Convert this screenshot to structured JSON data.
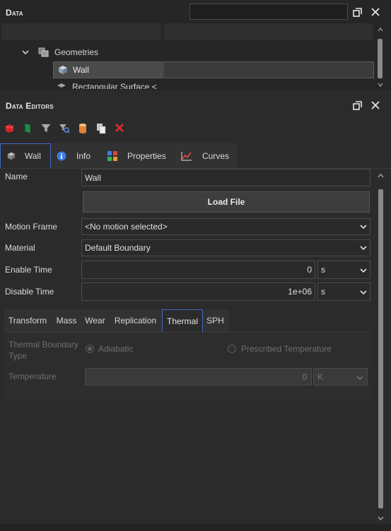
{
  "data_panel": {
    "title": "Data",
    "search": {
      "value": "",
      "placeholder": ""
    },
    "tree": {
      "geometries_label": "Geometries",
      "selected_item_label": "Wall",
      "next_item_label": "Rectangular Surface <"
    }
  },
  "editors_panel": {
    "title": "Data Editors",
    "toolbar_icons": [
      "cube-red-icon",
      "flag-green-icon",
      "filter-icon",
      "search-filter-icon",
      "cylinder-orange-icon",
      "copy-icon",
      "delete-icon"
    ]
  },
  "tabs": [
    {
      "label": "Wall",
      "icon": "wall-icon",
      "active": true
    },
    {
      "label": "Info",
      "icon": "info-icon",
      "active": false
    },
    {
      "label": "Properties",
      "icon": "properties-icon",
      "active": false
    },
    {
      "label": "Curves",
      "icon": "curves-icon",
      "active": false
    }
  ],
  "form": {
    "name_label": "Name",
    "name_value": "Wall",
    "load_file_label": "Load File",
    "motion_frame_label": "Motion Frame",
    "motion_frame_value": "<No motion selected>",
    "material_label": "Material",
    "material_value": "Default Boundary",
    "enable_time_label": "Enable Time",
    "enable_time_value": "0",
    "enable_time_unit": "s",
    "disable_time_label": "Disable Time",
    "disable_time_value": "1e+06",
    "disable_time_unit": "s"
  },
  "subtabs": [
    {
      "label": "Transform",
      "active": false
    },
    {
      "label": "Mass",
      "active": false
    },
    {
      "label": "Wear",
      "active": false
    },
    {
      "label": "Replication",
      "active": false
    },
    {
      "label": "Thermal",
      "active": true
    },
    {
      "label": "SPH",
      "active": false
    }
  ],
  "thermal": {
    "boundary_type_label": "Thermal Boundary Type",
    "adiabatic_label": "Adiabatic",
    "prescribed_label": "Prescribed Temperature",
    "selected": "Adiabatic",
    "temperature_label": "Temperature",
    "temperature_value": "0",
    "temperature_unit": "K"
  },
  "colors": {
    "accent": "#3f68c8",
    "background": "#2b2b2b",
    "panel": "#262626"
  }
}
